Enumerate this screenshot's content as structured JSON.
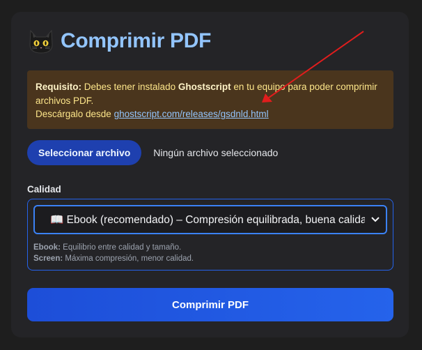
{
  "header": {
    "icon": "black-cat-icon",
    "title": "Comprimir PDF"
  },
  "requirement": {
    "prefix": "Requisito:",
    "text_before": " Debes tener instalado ",
    "software": "Ghostscript",
    "text_after": " en tu equipo para poder comprimir archivos PDF.",
    "download_text": "Descárgalo desde ",
    "download_link": "ghostscript.com/releases/gsdnld.html"
  },
  "file": {
    "button_label": "Seleccionar archivo",
    "status": "Ningún archivo seleccionado"
  },
  "quality": {
    "label": "Calidad",
    "selected_icon": "📖",
    "selected_text": "Ebook (recomendado) – Compresión equilibrada, buena calidad",
    "hints": [
      {
        "name": "Ebook:",
        "text": " Equilibrio entre calidad y tamaño."
      },
      {
        "name": "Screen:",
        "text": " Máxima compresión, menor calidad."
      }
    ]
  },
  "submit_label": "Comprimir PDF",
  "colors": {
    "accent": "#2563eb",
    "title": "#93c5fd",
    "warning_bg": "#4a351d",
    "annotation_arrow": "#e11d1d"
  }
}
